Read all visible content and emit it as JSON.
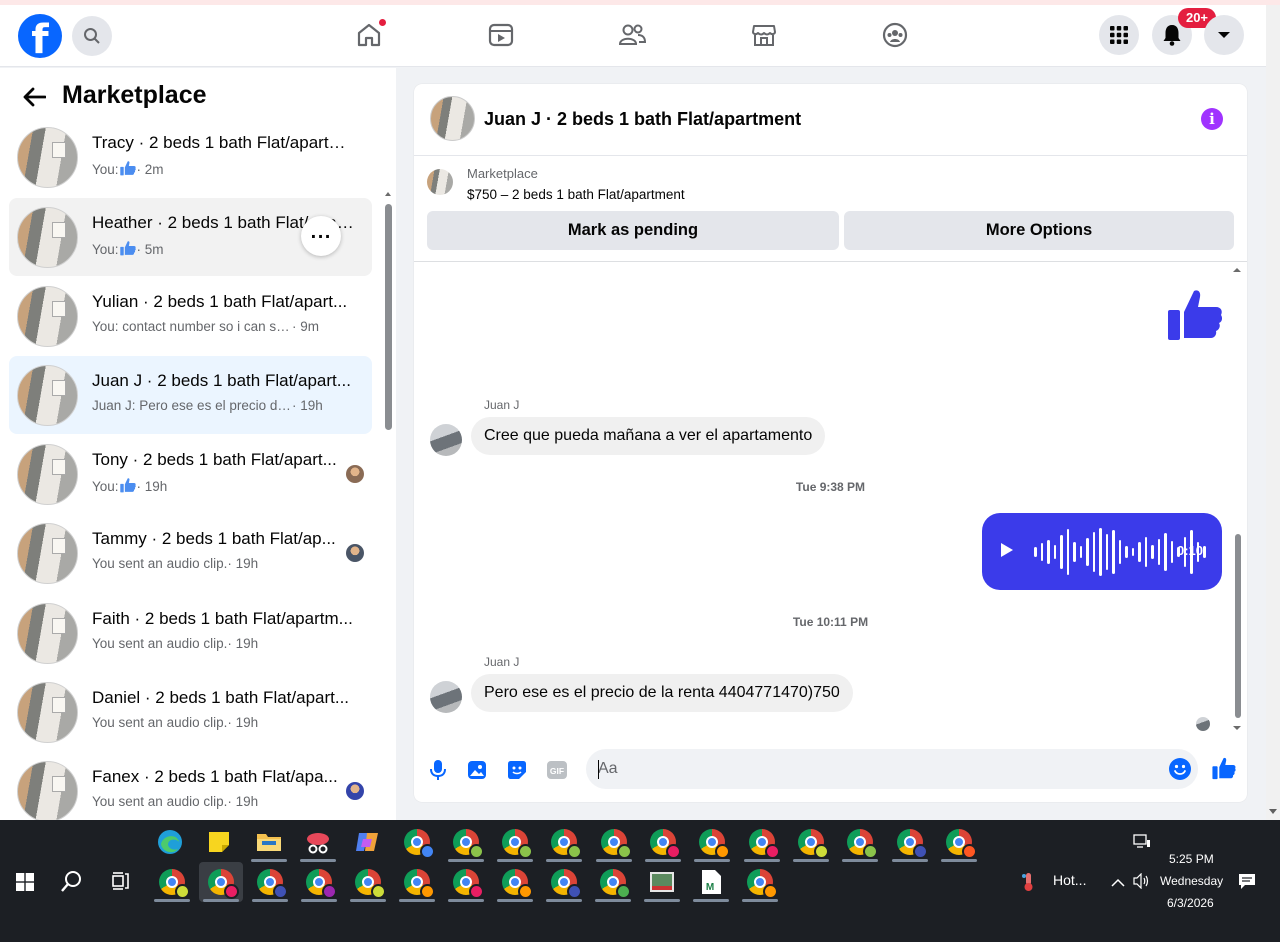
{
  "sidebar": {
    "title": "Marketplace",
    "conversations": [
      {
        "name": "Tracy · 2 beds 1 bath Flat/apartm...",
        "preview": "You: ",
        "thumbs": true,
        "time": "· 2m"
      },
      {
        "name": "Heather · 2 beds 1 bath Flat/apartm...",
        "preview": "You: ",
        "thumbs": true,
        "time": "· 5m"
      },
      {
        "name": "Yulian · 2 beds 1 bath Flat/apart...",
        "preview": "You: contact number so i can send ...",
        "thumbs": false,
        "time": " · 9m"
      },
      {
        "name": "Juan J · 2 beds 1 bath Flat/apart...",
        "preview": "Juan J: Pero ese es el precio de la r...",
        "thumbs": false,
        "time": " · 19h"
      },
      {
        "name": "Tony · 2 beds 1 bath Flat/apart...",
        "preview": "You: ",
        "thumbs": true,
        "time": "· 19h"
      },
      {
        "name": "Tammy · 2 beds 1 bath Flat/ap...",
        "preview": "You sent an audio clip.",
        "thumbs": false,
        "time": " · 19h"
      },
      {
        "name": "Faith · 2 beds 1 bath Flat/apartm...",
        "preview": "You sent an audio clip.",
        "thumbs": false,
        "time": " · 19h"
      },
      {
        "name": "Daniel · 2 beds 1 bath Flat/apart...",
        "preview": "You sent an audio clip.",
        "thumbs": false,
        "time": " · 19h"
      },
      {
        "name": "Fanex · 2 beds 1 bath Flat/apa...",
        "preview": "You sent an audio clip.",
        "thumbs": false,
        "time": " · 19h"
      }
    ]
  },
  "nav": {
    "notification_count": "20+"
  },
  "chat": {
    "title": "Juan J · 2 beds 1 bath Flat/apartment",
    "listing_label": "Marketplace",
    "listing_price": "$750 – 2 beds 1 bath Flat/apartment",
    "btn_pending": "Mark as pending",
    "btn_more": "More Options",
    "msg1_sender": "Juan J",
    "msg1_text": "Cree que pueda mañana a ver el apartamento",
    "ts1": "Tue 9:38 PM",
    "audio_duration": "0:10",
    "ts2": "Tue 10:11 PM",
    "msg2_sender": "Juan J",
    "msg2_text": "Pero ese es el precio de la renta 4404771470)750",
    "composer_placeholder": "Aa"
  },
  "taskbar": {
    "weather": "Hot...",
    "time": "5:25 PM",
    "day": "Wednesday",
    "date": "6/3/2026"
  },
  "colors": {
    "brand": "#0866ff",
    "messenger_purple": "#3b3bea",
    "notification_red": "#e41e3f"
  },
  "icons": [
    "facebook-logo",
    "search-icon",
    "home-icon",
    "video-icon",
    "friends-icon",
    "marketplace-icon",
    "groups-icon",
    "menu-grid-icon",
    "bell-icon",
    "caret-down-icon",
    "back-arrow-icon",
    "thumbs-up-icon",
    "info-icon",
    "play-icon",
    "mic-icon",
    "image-icon",
    "sticker-icon",
    "gif-icon",
    "emoji-icon",
    "windows-start-icon"
  ]
}
